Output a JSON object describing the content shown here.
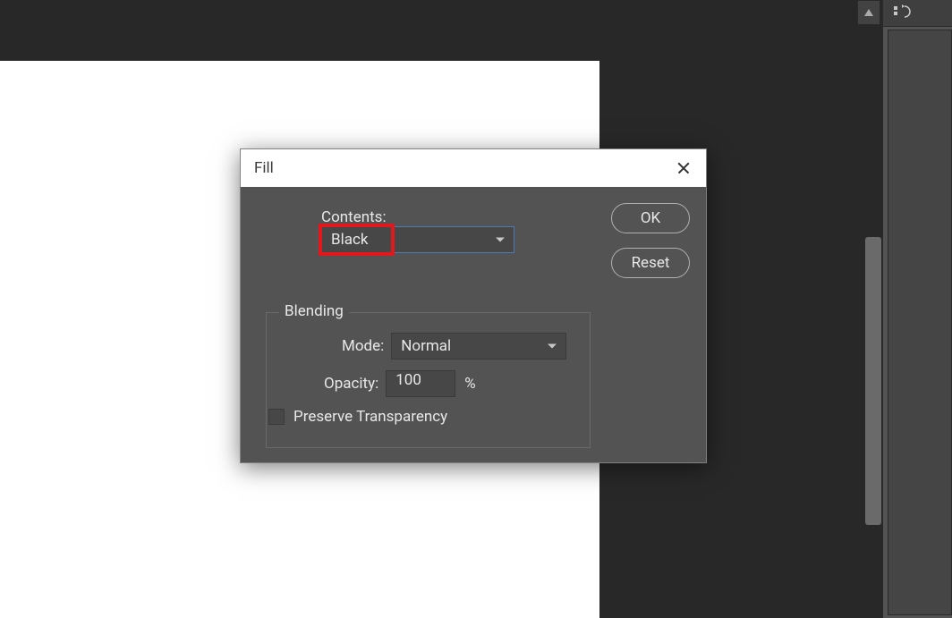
{
  "dialog": {
    "title": "Fill",
    "contents_label": "Contents:",
    "contents_value": "Black",
    "ok_label": "OK",
    "reset_label": "Reset",
    "blending": {
      "legend": "Blending",
      "mode_label": "Mode:",
      "mode_value": "Normal",
      "opacity_label": "Opacity:",
      "opacity_value": "100",
      "opacity_unit": "%",
      "preserve_transparency_label": "Preserve Transparency"
    }
  }
}
